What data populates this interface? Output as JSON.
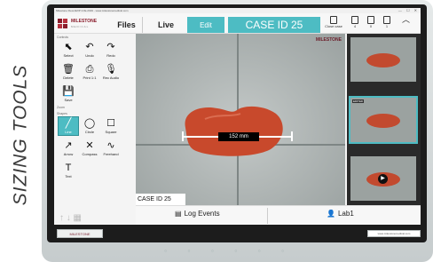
{
  "side_title": "SIZING TOOLS",
  "window": {
    "title": "Milestone Flexo/EXP 4.8a 2019 - www.milestonemedical.com",
    "controls": "— ☐ ✕"
  },
  "header": {
    "logo_name": "MILESTONE",
    "logo_sub": "MEDICAL",
    "tabs": [
      "Files",
      "Live",
      "Edit"
    ],
    "case_title": "CASE ID 25",
    "buttons": [
      {
        "label": "Close case",
        "icon": "folder-close-icon"
      },
      {
        "label": "4",
        "icon": "image-doc-icon"
      },
      {
        "label": "0",
        "icon": "video-doc-icon"
      },
      {
        "label": "1",
        "icon": "report-doc-icon"
      },
      {
        "label": "",
        "icon": "chevron-up-icon"
      }
    ]
  },
  "tools": {
    "controls_section": "Controls",
    "controls": [
      {
        "label": "Select",
        "glyph": "⬉"
      },
      {
        "label": "Undo",
        "glyph": "↶"
      },
      {
        "label": "Redo",
        "glyph": "↷"
      },
      {
        "label": "Delete",
        "glyph": "🗑"
      },
      {
        "label": "Print 1:1",
        "glyph": "⎙"
      },
      {
        "label": "Rec Audio",
        "glyph": "🎙"
      },
      {
        "label": "Save",
        "glyph": "💾"
      }
    ],
    "zoom_section": "Zoom",
    "shape_section": "Shapes",
    "shapes": [
      {
        "label": "Line",
        "glyph": "╱",
        "active": true
      },
      {
        "label": "Circle",
        "glyph": "◯"
      },
      {
        "label": "Square",
        "glyph": "☐"
      },
      {
        "label": "Arrow",
        "glyph": "↗"
      },
      {
        "label": "Compass",
        "glyph": "✕"
      },
      {
        "label": "Freehand",
        "glyph": "∿"
      },
      {
        "label": "Text",
        "glyph": "T"
      }
    ],
    "footer_icons": "↑ ↓ ▦"
  },
  "viewer": {
    "measurement": "152 mm",
    "case_label": "CASE ID 25",
    "watermark": "MILESTONE"
  },
  "thumbnails": [
    {
      "tag": "",
      "selected": false,
      "video": false
    },
    {
      "tag": "EDITED",
      "selected": true,
      "video": false
    },
    {
      "tag": "",
      "selected": false,
      "video": true
    }
  ],
  "bottom": {
    "log_events": "Log Events",
    "user": "Lab1"
  },
  "device": {
    "footer_logo": "MILESTONE",
    "footer_url": "www.milestonemedical.com",
    "footer_buttons": "○ ○ ○ ○ ○ ○"
  },
  "colors": {
    "accent": "#4dbcc3",
    "brand": "#8a1d2c",
    "specimen": "#c8492c"
  }
}
